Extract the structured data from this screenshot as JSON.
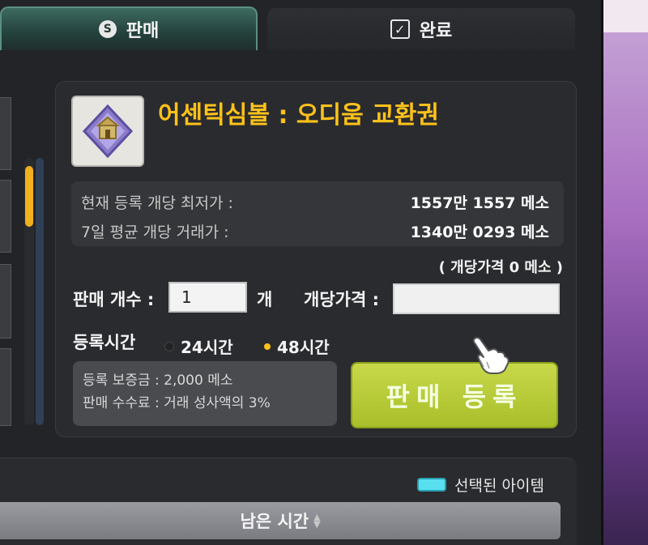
{
  "tabs": {
    "sell": {
      "label": "판매",
      "icon": "coin-icon"
    },
    "done": {
      "label": "완료",
      "icon": "check-icon"
    }
  },
  "item": {
    "name": "어센틱심볼 : 오디움 교환권",
    "name_color": "#ffc21a"
  },
  "prices": {
    "lowest_label": "현재 등록 개당 최저가 :",
    "lowest_value": "1557만 1557 메소",
    "avg_label": "7일  평균 개당 거래가 :",
    "avg_value": "1340만 0293 메소"
  },
  "per_unit_note": "( 개당가격 0 메소 )",
  "form": {
    "qty_label": "판매 개수 :",
    "qty_value": "1",
    "qty_unit": "개",
    "price_label": "개당가격 :",
    "price_value": ""
  },
  "duration": {
    "label": "등록시간",
    "option_24": "24시간",
    "option_48": "48시간",
    "selected": "48시간"
  },
  "fees": {
    "deposit": "등록 보증금 : 2,000 메소",
    "commission": "판매 수수료 : 거래 성사액의 3%"
  },
  "register_button": "판매 등록",
  "accent_color": "#b8cc36",
  "legend": {
    "selected_item": "선택된 아이템",
    "swatch_color": "#58e0f0"
  },
  "sort": {
    "remaining_time": "남은 시간"
  }
}
